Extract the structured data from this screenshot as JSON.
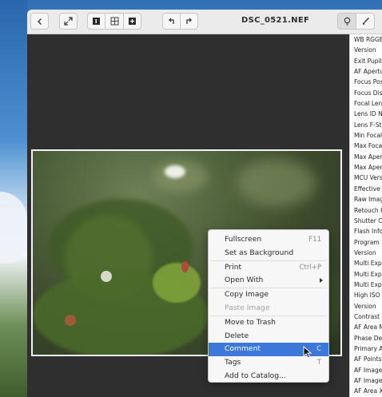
{
  "window": {
    "title": "DSC_0521.NEF"
  },
  "toolbar": {
    "back_icon": "chevron-left-icon",
    "fullscreen_icon": "expand-arrows-icon",
    "view_single_icon": "single-image-icon",
    "view_grid_icon": "grid-icon",
    "view_add_icon": "plus-box-icon",
    "rotate_left_icon": "rotate-left-icon",
    "rotate_right_icon": "rotate-right-icon",
    "properties_icon": "lightbulb-icon",
    "edit_icon": "brush-icon"
  },
  "properties": {
    "rows": [
      "WB RGGB",
      "Version",
      "Exit Pupil",
      "AF Apertu",
      "Focus Pos",
      "Focus Dis",
      "Focal Len",
      "Lens ID N",
      "Lens F-St",
      "Min Focal",
      "Max Foca",
      "Max Aper",
      "Max Aper",
      "MCU Vers",
      "Effective",
      "Raw Imag",
      "Retouch H",
      "Shutter C",
      "Flash Info",
      "Program",
      "Version",
      "Multi Exp",
      "Multi Exp",
      "Multi Exp",
      "High ISO",
      "Version",
      "Contrast",
      "AF Area M",
      "Phase De",
      "Primary A",
      "AF Points",
      "AF Image",
      "AF Image",
      "AF Area X"
    ]
  },
  "context_menu": {
    "items": [
      {
        "label": "Fullscreen",
        "accel": "F11"
      },
      {
        "label": "Set as Background",
        "accel": ""
      },
      {
        "label": "Print",
        "accel": "Ctrl+P"
      },
      {
        "label": "Open With",
        "accel": ""
      },
      {
        "label": "Copy Image",
        "accel": ""
      },
      {
        "label": "Paste Image",
        "accel": ""
      },
      {
        "label": "Move to Trash",
        "accel": ""
      },
      {
        "label": "Delete",
        "accel": ""
      },
      {
        "label": "Comment",
        "accel": "C"
      },
      {
        "label": "Tags",
        "accel": "T"
      },
      {
        "label": "Add to Catalog...",
        "accel": ""
      }
    ],
    "highlighted": "Comment",
    "disabled": [
      "Paste Image"
    ]
  },
  "colors": {
    "accent": "#3c78d8",
    "viewer_bg": "#2f2f2f",
    "titlebar_bg": "#ebebeb"
  }
}
